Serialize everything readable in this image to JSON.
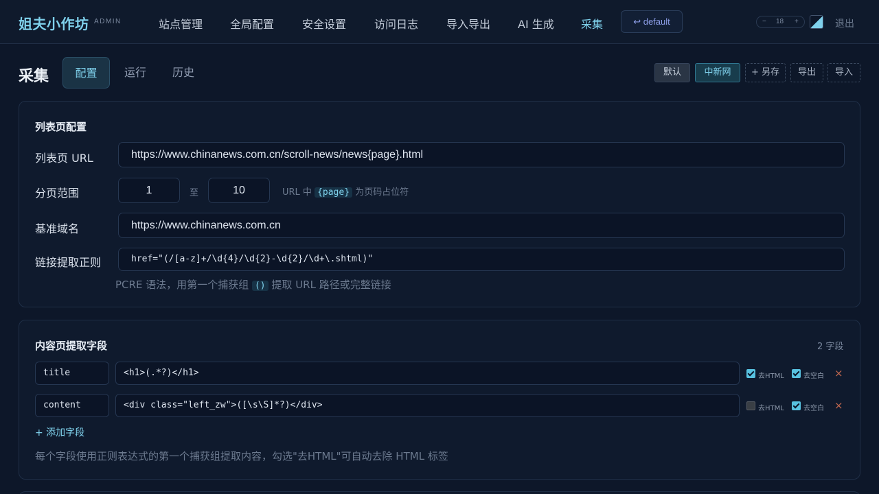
{
  "nav": {
    "brand": "姐夫小作坊",
    "brand_sub": "ADMIN",
    "items": [
      {
        "label": "站点管理"
      },
      {
        "label": "全局配置"
      },
      {
        "label": "安全设置"
      },
      {
        "label": "访问日志"
      },
      {
        "label": "导入导出"
      },
      {
        "label": "AI 生成"
      },
      {
        "label": "采集",
        "active": true
      }
    ],
    "default_button": "↩ default",
    "font_size": {
      "minus": "−",
      "value": "18",
      "plus": "+"
    },
    "logout": "退出"
  },
  "page": {
    "title": "采集",
    "tabs": [
      {
        "label": "配置",
        "active": true
      },
      {
        "label": "运行"
      },
      {
        "label": "历史"
      }
    ],
    "presets": {
      "default": "默认",
      "selected": "中新网",
      "save_as": "+ 另存",
      "export": "导出",
      "import": "导入"
    }
  },
  "list_config": {
    "title": "列表页配置",
    "url_label": "列表页 URL",
    "url_value": "https://www.chinanews.com.cn/scroll-news/news{page}.html",
    "page_label": "分页范围",
    "page_from": "1",
    "page_to_sep": "至",
    "page_to": "10",
    "page_hint_pre": "URL 中",
    "page_hint_code": "{page}",
    "page_hint_post": "为页码占位符",
    "base_label": "基准域名",
    "base_value": "https://www.chinanews.com.cn",
    "link_label": "链接提取正则",
    "link_value": "href=\"(/[a-z]+/\\d{4}/\\d{2}-\\d{2}/\\d+\\.shtml)\"",
    "link_hint_pre": "PCRE 语法，用第一个捕获组",
    "link_hint_code": "()",
    "link_hint_post": "提取 URL 路径或完整链接"
  },
  "content_fields": {
    "title": "内容页提取字段",
    "count": "2 字段",
    "fields": [
      {
        "name": "title",
        "regex": "<h1>(.*?)</h1>",
        "strip_html": true,
        "trim": true
      },
      {
        "name": "content",
        "regex": "<div class=\"left_zw\">([\\s\\S]*?)</div>",
        "strip_html": false,
        "trim": true
      }
    ],
    "strip_html_label": "去HTML",
    "trim_label": "去空白",
    "remove_icon": "×",
    "add_field": "+ 添加字段",
    "footer_hint": "每个字段使用正则表达式的第一个捕获组提取内容，勾选\"去HTML\"可自动去除 HTML 标签"
  },
  "colors": {
    "background": "#0d1729",
    "accent": "#7fd1ec",
    "card": "#0f1a2d",
    "remove": "#c0674f"
  }
}
